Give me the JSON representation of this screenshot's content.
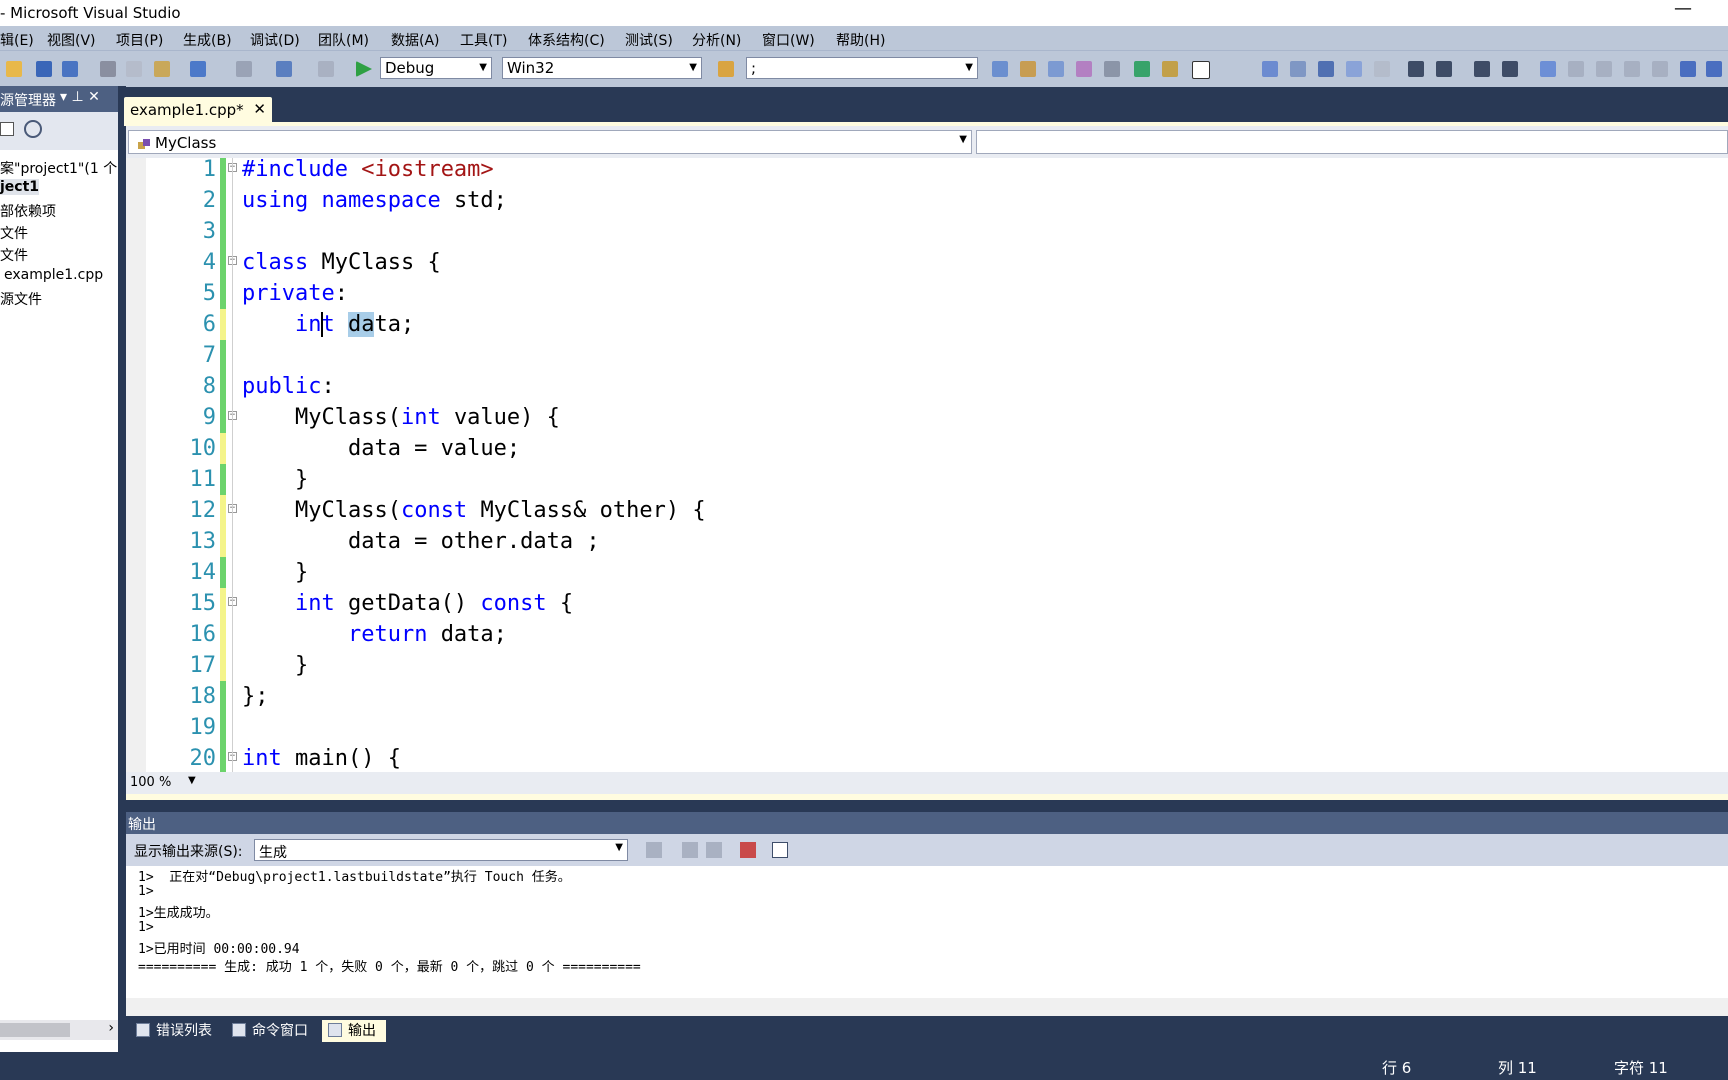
{
  "window": {
    "title": "- Microsoft Visual Studio",
    "minimize": "—"
  },
  "menu": [
    "辑(E)",
    "视图(V)",
    "项目(P)",
    "生成(B)",
    "调试(D)",
    "团队(M)",
    "数据(A)",
    "工具(T)",
    "体系结构(C)",
    "测试(S)",
    "分析(N)",
    "窗口(W)",
    "帮助(H)"
  ],
  "toolbar": {
    "config": "Debug",
    "platform": "Win32",
    "find_value": ";"
  },
  "solution_explorer": {
    "title": "源管理器",
    "pin": "▾ ⊥ ✕",
    "items": [
      "案\"project1\"(1 个",
      "ject1",
      "部依赖项",
      "文件",
      "文件",
      "example1.cpp",
      "源文件"
    ]
  },
  "editor": {
    "tab_title": "example1.cpp*",
    "tab_close": "✕",
    "nav_scope": "MyClass",
    "zoom": "100 %",
    "lines": [
      {
        "n": "1",
        "parts": [
          [
            "kw",
            "#include "
          ],
          [
            "str",
            "<iostream>"
          ]
        ]
      },
      {
        "n": "2",
        "parts": [
          [
            "kw",
            "using "
          ],
          [
            "kw",
            "namespace "
          ],
          [
            "",
            "std;"
          ]
        ]
      },
      {
        "n": "3",
        "parts": []
      },
      {
        "n": "4",
        "parts": [
          [
            "kw",
            "class "
          ],
          [
            "",
            "MyClass {"
          ]
        ]
      },
      {
        "n": "5",
        "parts": [
          [
            "kw",
            "private"
          ],
          [
            "",
            ":"
          ]
        ]
      },
      {
        "n": "6",
        "parts": [
          [
            "",
            "    "
          ],
          [
            "kw",
            "int "
          ],
          [
            "sel",
            "da"
          ],
          [
            "",
            "ta;"
          ]
        ]
      },
      {
        "n": "7",
        "parts": []
      },
      {
        "n": "8",
        "parts": [
          [
            "kw",
            "public"
          ],
          [
            "",
            ":"
          ]
        ]
      },
      {
        "n": "9",
        "parts": [
          [
            "",
            "    MyClass("
          ],
          [
            "kw",
            "int "
          ],
          [
            "",
            "value) {"
          ]
        ]
      },
      {
        "n": "10",
        "parts": [
          [
            "",
            "        data = value;"
          ]
        ]
      },
      {
        "n": "11",
        "parts": [
          [
            "",
            "    }"
          ]
        ]
      },
      {
        "n": "12",
        "parts": [
          [
            "",
            "    MyClass("
          ],
          [
            "kw",
            "const "
          ],
          [
            "",
            "MyClass& other) {"
          ]
        ]
      },
      {
        "n": "13",
        "parts": [
          [
            "",
            "        data = other.data ;"
          ]
        ]
      },
      {
        "n": "14",
        "parts": [
          [
            "",
            "    }"
          ]
        ]
      },
      {
        "n": "15",
        "parts": [
          [
            "",
            "    "
          ],
          [
            "kw",
            "int "
          ],
          [
            "",
            "getData() "
          ],
          [
            "kw",
            "const "
          ],
          [
            "",
            "{"
          ]
        ]
      },
      {
        "n": "16",
        "parts": [
          [
            "",
            "        "
          ],
          [
            "kw",
            "return "
          ],
          [
            "",
            "data;"
          ]
        ]
      },
      {
        "n": "17",
        "parts": [
          [
            "",
            "    }"
          ]
        ]
      },
      {
        "n": "18",
        "parts": [
          [
            "",
            "};"
          ]
        ]
      },
      {
        "n": "19",
        "parts": []
      },
      {
        "n": "20",
        "parts": [
          [
            "kw",
            "int "
          ],
          [
            "",
            "main() {"
          ]
        ]
      }
    ]
  },
  "output": {
    "title": "输出",
    "source_label": "显示输出来源(S):",
    "source_value": "生成",
    "lines": [
      "1>  正在对“Debug\\project1.lastbuildstate”执行 Touch 任务。",
      "1>",
      "1>生成成功。",
      "1>",
      "1>已用时间 00:00:00.94",
      "========== 生成: 成功 1 个，失败 0 个，最新 0 个，跳过 0 个 =========="
    ]
  },
  "bottom_tabs": [
    "错误列表",
    "命令窗口",
    "输出"
  ],
  "status": {
    "row": "行 6",
    "col": "列 11",
    "char": "字符 11"
  },
  "colors": {
    "chrome": "#293955",
    "panel_header": "#4d6082",
    "keyword": "#0000ff",
    "string": "#a31515",
    "line_number": "#2b91af",
    "changed_saved": "#6cd36c",
    "changed_unsaved": "#f4f48a"
  }
}
